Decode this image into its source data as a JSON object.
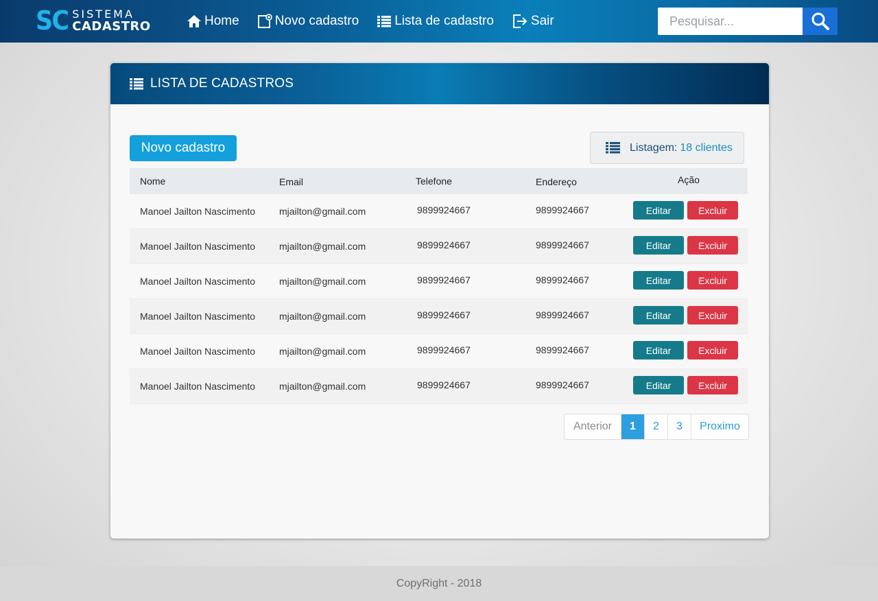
{
  "header": {
    "logo_mark": "SC",
    "logo_top": "SISTEMA",
    "logo_bottom": "CADASTRO",
    "nav": [
      {
        "label": "Home",
        "icon": "home-icon"
      },
      {
        "label": "Novo cadastro",
        "icon": "new-document-icon"
      },
      {
        "label": "Lista de cadastro",
        "icon": "list-icon"
      },
      {
        "label": "Sair",
        "icon": "logout-icon"
      }
    ],
    "search_placeholder": "Pesquisar...",
    "colors": {
      "accent": "#1fb3ea",
      "search_button": "#1a6fd6"
    }
  },
  "panel": {
    "title": "LISTA DE CADASTROS",
    "new_button": "Novo cadastro",
    "listing_label": "Listagem:",
    "listing_count": "18 clientes",
    "columns": [
      "Nome",
      "Email",
      "Telefone",
      "Endereço",
      "Ação"
    ],
    "rows": [
      {
        "nome": "Manoel Jailton Nascimento",
        "email": "mjailton@gmail.com",
        "telefone": "9899924667",
        "endereco": "9899924667"
      },
      {
        "nome": "Manoel Jailton Nascimento",
        "email": "mjailton@gmail.com",
        "telefone": "9899924667",
        "endereco": "9899924667"
      },
      {
        "nome": "Manoel Jailton Nascimento",
        "email": "mjailton@gmail.com",
        "telefone": "9899924667",
        "endereco": "9899924667"
      },
      {
        "nome": "Manoel Jailton Nascimento",
        "email": "mjailton@gmail.com",
        "telefone": "9899924667",
        "endereco": "9899924667"
      },
      {
        "nome": "Manoel Jailton Nascimento",
        "email": "mjailton@gmail.com",
        "telefone": "9899924667",
        "endereco": "9899924667"
      },
      {
        "nome": "Manoel Jailton Nascimento",
        "email": "mjailton@gmail.com",
        "telefone": "9899924667",
        "endereco": "9899924667"
      }
    ],
    "edit_label": "Editar",
    "delete_label": "Excluir",
    "colors": {
      "edit": "#157a8a",
      "delete": "#dc3545",
      "new_button": "#14a0dc"
    }
  },
  "pagination": {
    "prev": "Anterior",
    "pages": [
      "1",
      "2",
      "3"
    ],
    "active_page": "1",
    "next": "Proximo"
  },
  "footer": {
    "text": "CopyRight - 2018"
  }
}
